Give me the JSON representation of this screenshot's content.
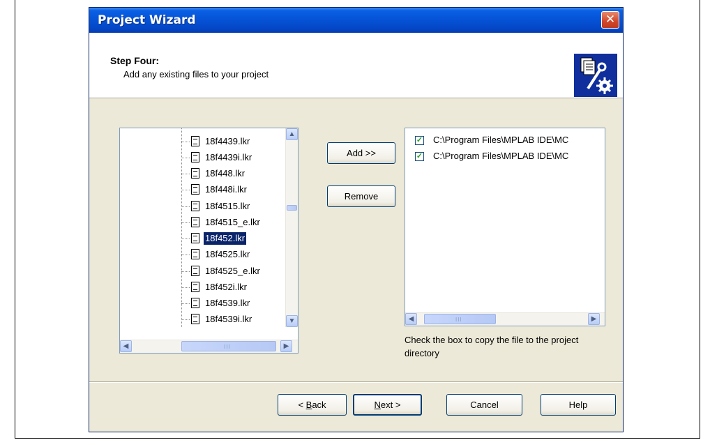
{
  "window": {
    "title": "Project Wizard",
    "close_glyph": "✕"
  },
  "header": {
    "step_title": "Step Four:",
    "step_description": "Add any existing files to your project",
    "icon": "files-wrench-gear-icon"
  },
  "tree": {
    "items": [
      {
        "label": "18f4439.lkr",
        "selected": false
      },
      {
        "label": "18f4439i.lkr",
        "selected": false
      },
      {
        "label": "18f448.lkr",
        "selected": false
      },
      {
        "label": "18f448i.lkr",
        "selected": false
      },
      {
        "label": "18f4515.lkr",
        "selected": false
      },
      {
        "label": "18f4515_e.lkr",
        "selected": false
      },
      {
        "label": "18f452.lkr",
        "selected": true
      },
      {
        "label": "18f4525.lkr",
        "selected": false
      },
      {
        "label": "18f4525_e.lkr",
        "selected": false
      },
      {
        "label": "18f452i.lkr",
        "selected": false
      },
      {
        "label": "18f4539.lkr",
        "selected": false
      },
      {
        "label": "18f4539i.lkr",
        "selected": false
      }
    ],
    "scroll_up_glyph": "▲",
    "scroll_down_glyph": "▼",
    "scroll_left_glyph": "◀",
    "scroll_right_glyph": "▶",
    "grip": "III"
  },
  "buttons": {
    "add": "Add >>",
    "remove": "Remove",
    "back_prefix": "< ",
    "back_key": "B",
    "back_rest": "ack",
    "next_key": "N",
    "next_rest": "ext >",
    "cancel": "Cancel",
    "help": "Help"
  },
  "project_files": {
    "items": [
      {
        "path": "C:\\Program Files\\MPLAB IDE\\MC",
        "checked": true
      },
      {
        "path": "C:\\Program Files\\MPLAB IDE\\MC",
        "checked": true
      }
    ],
    "check_glyph": "✓",
    "hint": "Check the box to copy the file to the project directory"
  }
}
